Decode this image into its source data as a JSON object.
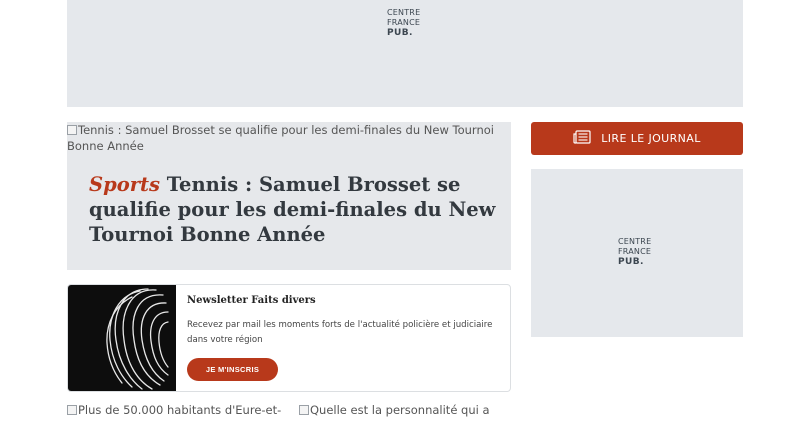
{
  "ad_banner": {
    "logo_line1": "CENTRE",
    "logo_line2": "FRANCE",
    "logo_line3": "PUB."
  },
  "hero": {
    "image_alt": "Tennis : Samuel Brosset se qualifie pour les demi-finales du New Tournoi Bonne Année",
    "kicker": "Sports",
    "title": "Tennis : Samuel Brosset se qualifie pour les demi-finales du New Tournoi Bonne Année"
  },
  "newsletter": {
    "title": "Newsletter Faits divers",
    "description": "Recevez par mail les moments forts de l'actualité policière et judiciaire dans votre région",
    "button_label": "JE M'INSCRIS"
  },
  "sidebar": {
    "read_button_label": "LIRE LE JOURNAL",
    "read_icon": "newspaper-icon",
    "ad": {
      "logo_line1": "CENTRE",
      "logo_line2": "FRANCE",
      "logo_line3": "PUB."
    }
  },
  "bottom_articles": [
    {
      "image_alt": "Plus de 50.000 habitants d'Eure-et-"
    },
    {
      "image_alt": "Quelle est la personnalité qui a"
    }
  ],
  "colors": {
    "accent": "#b8391b",
    "ad_background": "#e5e8ec",
    "hero_background": "#e6e8eb"
  }
}
